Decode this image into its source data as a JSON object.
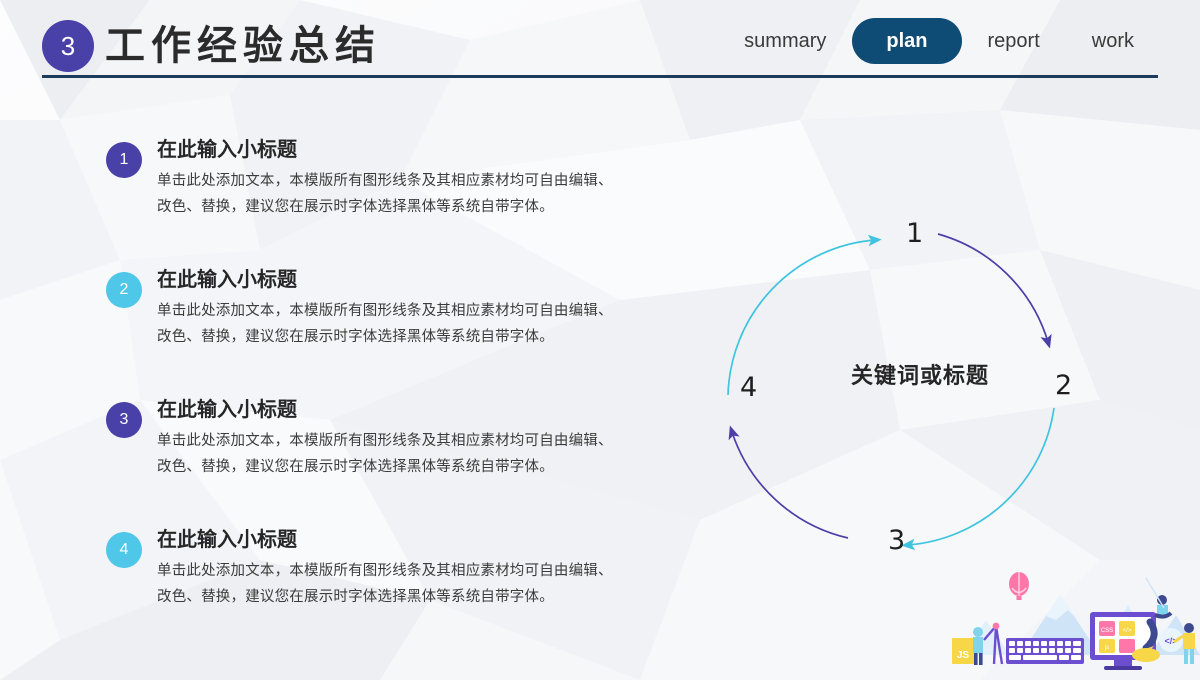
{
  "header": {
    "section_number": "3",
    "title": "工作经验总结",
    "nav": [
      {
        "label": "summary",
        "active": false
      },
      {
        "label": "plan",
        "active": true
      },
      {
        "label": "report",
        "active": false
      },
      {
        "label": "work",
        "active": false
      }
    ],
    "rule_color": "#1b3a5c",
    "active_pill_color": "#0f4c75",
    "badge_color": "#4940a8"
  },
  "list": {
    "items": [
      {
        "number": "1",
        "color": "#4940a8",
        "title": "在此输入小标题",
        "line1": "单击此处添加文本，本模版所有图形线条及其相应素材均可自由编辑、",
        "line2": "改色、替换，建议您在展示时字体选择黑体等系统自带字体。"
      },
      {
        "number": "2",
        "color": "#4ec7e8",
        "title": "在此输入小标题",
        "line1": "单击此处添加文本，本模版所有图形线条及其相应素材均可自由编辑、",
        "line2": "改色、替换，建议您在展示时字体选择黑体等系统自带字体。"
      },
      {
        "number": "3",
        "color": "#4940a8",
        "title": "在此输入小标题",
        "line1": "单击此处添加文本，本模版所有图形线条及其相应素材均可自由编辑、",
        "line2": "改色、替换，建议您在展示时字体选择黑体等系统自带字体。"
      },
      {
        "number": "4",
        "color": "#4ec7e8",
        "title": "在此输入小标题",
        "line1": "单击此处添加文本，本模版所有图形线条及其相应素材均可自由编辑、",
        "line2": "改色、替换，建议您在展示时字体选择黑体等系统自带字体。"
      }
    ]
  },
  "cycle": {
    "center_label": "关键词或标题",
    "nodes": [
      {
        "label": "1",
        "position": "top"
      },
      {
        "label": "2",
        "position": "right"
      },
      {
        "label": "3",
        "position": "bottom"
      },
      {
        "label": "4",
        "position": "left"
      }
    ],
    "arc_colors": {
      "cyan": "#3fc4e0",
      "purple": "#4b3fa8"
    },
    "direction": "clockwise"
  },
  "illustration": {
    "name": "developers-workspace-illustration",
    "tags": [
      "JS",
      "CSS",
      "js",
      "</>"
    ]
  }
}
